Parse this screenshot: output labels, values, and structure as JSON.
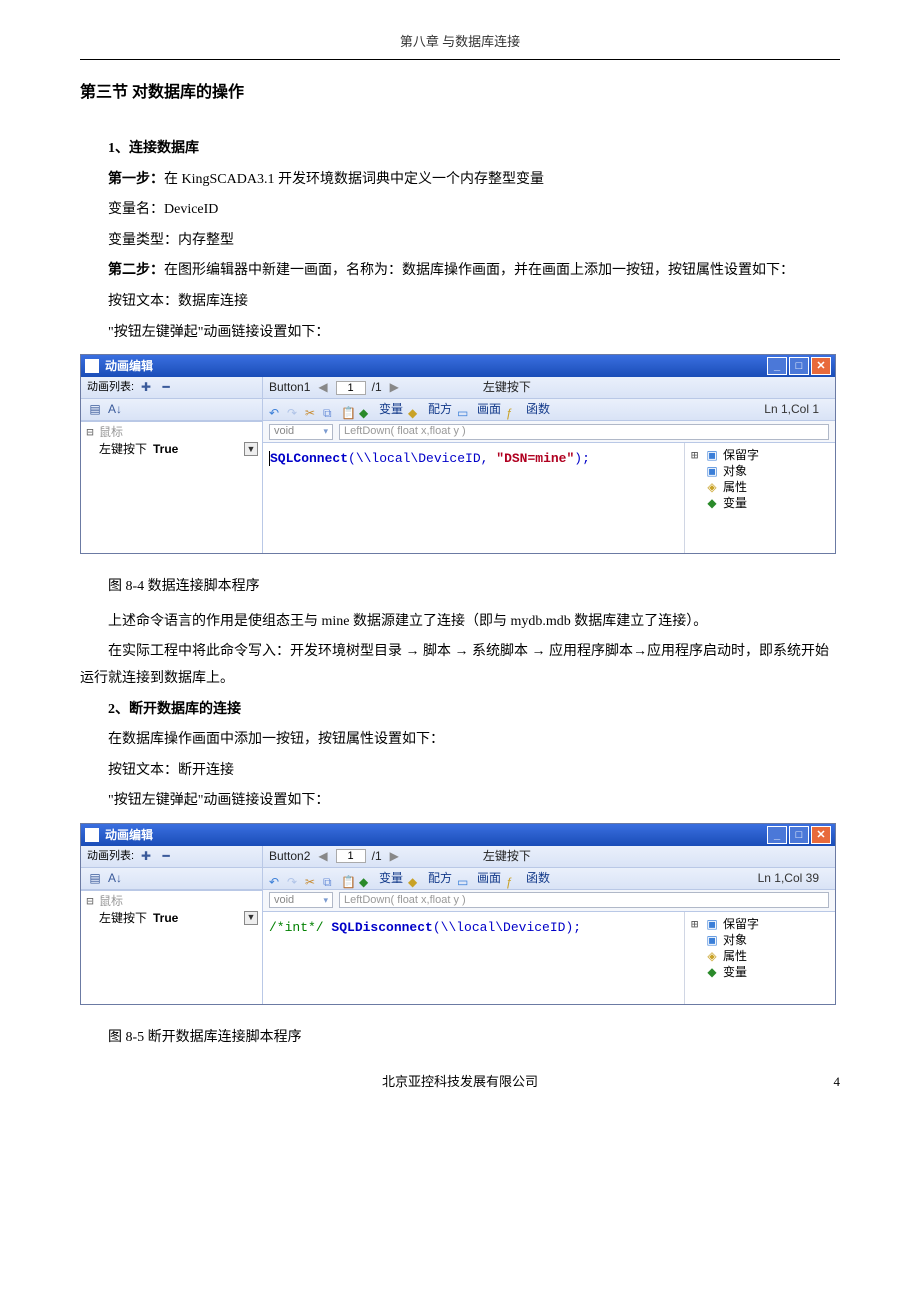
{
  "chapter_header": "第八章 与数据库连接",
  "section_title": "第三节  对数据库的操作",
  "h1": "1、连接数据库",
  "p_step1": "第一步：",
  "p_step1_rest": "在 KingSCADA3.1 开发环境数据词典中定义一个内存整型变量",
  "p_varname": "变量名：DeviceID",
  "p_vartype": "变量类型：内存整型",
  "p_step2": "第二步：",
  "p_step2_rest": "在图形编辑器中新建一画面，名称为：数据库操作画面，并在画面上添加一按钮，按钮属性设置如下：",
  "p_btntext1": "按钮文本：数据库连接",
  "p_anim1": "\"按钮左键弹起\"动画链接设置如下：",
  "editor1": {
    "title": "动画编辑",
    "left_header": "动画列表:",
    "tree_group": "鼠标",
    "tree_item": "左键按下",
    "tree_val": "True",
    "nav_button": "Button1",
    "nav_page": "1",
    "nav_total": "/1",
    "nav_event": "左键按下",
    "tb": {
      "var": "变量",
      "recipe": "配方",
      "screen": "画面",
      "func": "函数"
    },
    "lncol": "Ln 1,Col 1",
    "sig_void": "void",
    "sig_func": "LeftDown( float x,float y )",
    "code_fn": "SQLConnect",
    "code_arg1": "(\\\\local\\DeviceID,",
    "code_str": "\"DSN=mine\"",
    "code_end": ");",
    "side": {
      "reserved": "保留字",
      "object": "对象",
      "attr": "属性",
      "var": "变量"
    }
  },
  "fig1_caption": "图 8-4 数据连接脚本程序",
  "p_desc1": "上述命令语言的作用是使组态王与 mine 数据源建立了连接（即与 mydb.mdb 数据库建立了连接）。",
  "p_desc2": "在实际工程中将此命令写入：开发环境树型目录 → 脚本 → 系统脚本 → 应用程序脚本→应用程序启动时，即系统开始运行就连接到数据库上。",
  "h2": "2、断开数据库的连接",
  "p2a": "在数据库操作画面中添加一按钮，按钮属性设置如下：",
  "p2b": "按钮文本：断开连接",
  "p2c": "\"按钮左键弹起\"动画链接设置如下：",
  "editor2": {
    "title": "动画编辑",
    "left_header": "动画列表:",
    "tree_group": "鼠标",
    "tree_item": "左键按下",
    "tree_val": "True",
    "nav_button": "Button2",
    "nav_page": "1",
    "nav_total": "/1",
    "nav_event": "左键按下",
    "tb": {
      "var": "变量",
      "recipe": "配方",
      "screen": "画面",
      "func": "函数"
    },
    "lncol": "Ln 1,Col 39",
    "sig_void": "void",
    "sig_func": "LeftDown( float x,float y )",
    "code_cmt": "/*int*/",
    "code_fn": "SQLDisconnect",
    "code_arg": "(\\\\local\\DeviceID);",
    "side": {
      "reserved": "保留字",
      "object": "对象",
      "attr": "属性",
      "var": "变量"
    }
  },
  "fig2_caption": "图 8-5 断开数据库连接脚本程序",
  "footer_company": "北京亚控科技发展有限公司",
  "page_number": "4"
}
